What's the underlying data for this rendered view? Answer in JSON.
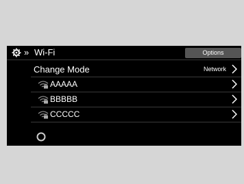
{
  "header": {
    "breadcrumb_glyph": "»",
    "title": "Wi-Fi",
    "options_label": "Options",
    "icon": "gear-icon"
  },
  "change_mode": {
    "label": "Change Mode",
    "value": "Network"
  },
  "networks": [
    {
      "name": "AAAAA",
      "icon": "wifi-locked-icon"
    },
    {
      "name": "BBBBB",
      "icon": "wifi-locked-icon"
    },
    {
      "name": "CCCCC",
      "icon": "wifi-locked-icon"
    }
  ],
  "status": {
    "icon": "loading-spinner-icon"
  }
}
